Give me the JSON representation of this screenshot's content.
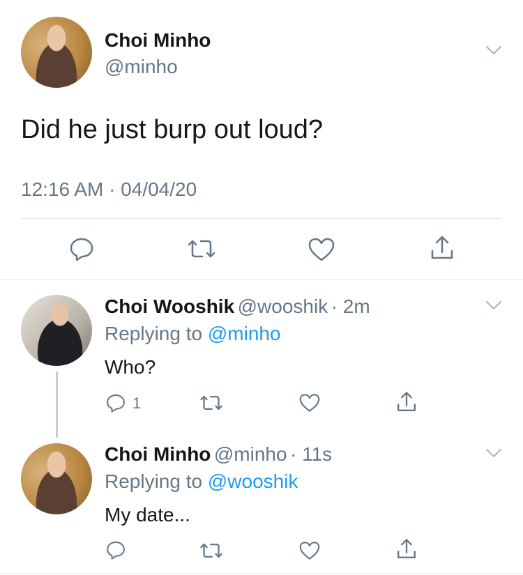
{
  "main_tweet": {
    "author_name": "Choi Minho",
    "author_handle": "@minho",
    "text": "Did he just burp out loud?",
    "timestamp": "12:16 AM · 04/04/20"
  },
  "replies": [
    {
      "author_name": "Choi Wooshik",
      "author_handle": "@wooshik",
      "time": "· 2m",
      "replying_prefix": "Replying to ",
      "replying_handle": "@minho",
      "text": "Who?",
      "reply_count": "1"
    },
    {
      "author_name": "Choi Minho",
      "author_handle": "@minho",
      "time": "· 11s",
      "replying_prefix": "Replying to ",
      "replying_handle": "@wooshik",
      "text": "My date...",
      "reply_count": ""
    }
  ],
  "icons": [
    "chevron-down-icon",
    "reply-icon",
    "retweet-icon",
    "like-icon",
    "share-icon"
  ],
  "colors": {
    "link": "#1d9bf0",
    "secondary_text": "#657786",
    "icon_gray": "#657786"
  }
}
